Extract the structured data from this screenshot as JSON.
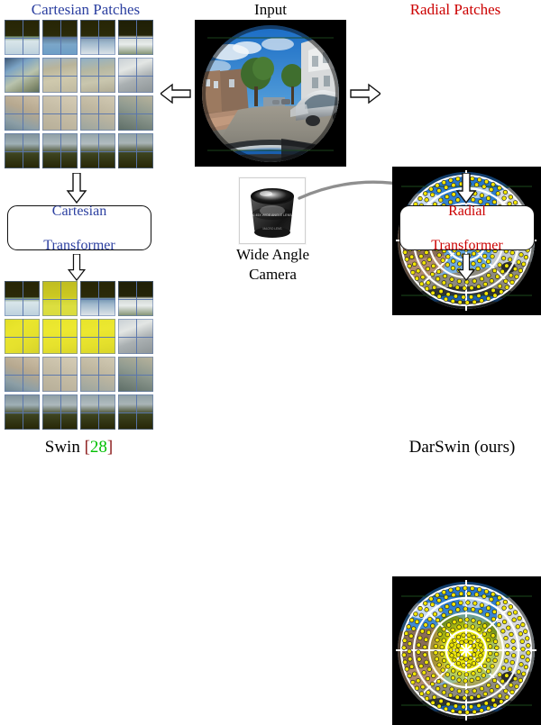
{
  "figure": {
    "columns": {
      "left": {
        "title": "Cartesian Patches",
        "title_color": "#2b3fa0",
        "transformer_label_line1": "Cartesian",
        "transformer_label_line2": "Transformer",
        "transformer_color": "#2b3fa0",
        "caption_main": "Swin",
        "caption_ref_open": "[",
        "caption_ref_num": "28",
        "caption_ref_close": "]",
        "caption_ref_color": "#00c000",
        "caption_bracket_color": "#8b1a1a"
      },
      "middle": {
        "title": "Input",
        "title_color": "#000000",
        "camera_caption_line1": "Wide Angle",
        "camera_caption_line2": "Camera",
        "camera_caption_color": "#000000",
        "image_alt": "fisheye-street-scene-with-parked-cars"
      },
      "right": {
        "title": "Radial Patches",
        "title_color": "#cc0000",
        "transformer_label_line1": "Radial",
        "transformer_label_line2": "Transformer",
        "transformer_color": "#cc0000",
        "caption_main": "DarSwin (ours)",
        "caption_color": "#000000"
      }
    },
    "arrows": {
      "left_arrow": "arrow-left",
      "right_arrow": "arrow-right",
      "down_arrow": "arrow-down",
      "camera_link": "curved-cable-to-radial-transformer"
    },
    "patch_grid": {
      "blocks_per_side": 4,
      "patches_per_block": 2,
      "grid_line_color": "#5a76ad"
    },
    "radial_grid": {
      "rings": 4,
      "angular_sectors": 8,
      "token_color": "#f2e600",
      "arc_color": "#ffffff"
    },
    "attention": {
      "swin_highlight_color": "#e6e400",
      "darswin_highlight_color": "#f2e600",
      "swin_highlighted_blocks": [
        1,
        4,
        6
      ],
      "darswin_highlighted_rings": [
        0,
        1
      ]
    }
  }
}
